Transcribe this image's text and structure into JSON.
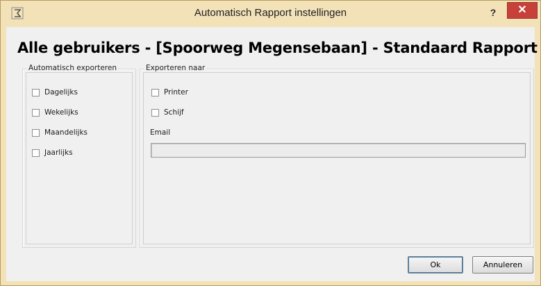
{
  "window": {
    "title": "Automatisch Rapport instellingen",
    "help_label": "?",
    "close_label": "✕",
    "icon": "app-icon"
  },
  "heading": "Alle gebruikers - [Spoorweg Megensebaan] - Standaard Rapport",
  "auto_export": {
    "legend": "Automatisch exporteren",
    "options": [
      {
        "label": "Dagelijks",
        "checked": false
      },
      {
        "label": "Wekelijks",
        "checked": false
      },
      {
        "label": "Maandelijks",
        "checked": false
      },
      {
        "label": "Jaarlijks",
        "checked": false
      }
    ]
  },
  "export_to": {
    "legend": "Exporteren naar",
    "options": [
      {
        "label": "Printer",
        "checked": false
      },
      {
        "label": "Schijf",
        "checked": false
      }
    ],
    "email_label": "Email",
    "email_value": ""
  },
  "buttons": {
    "ok": "Ok",
    "cancel": "Annuleren"
  },
  "colors": {
    "title_bar": "#f3e2b8",
    "close_button": "#c7403a",
    "dialog_background": "#f0f0f0"
  }
}
